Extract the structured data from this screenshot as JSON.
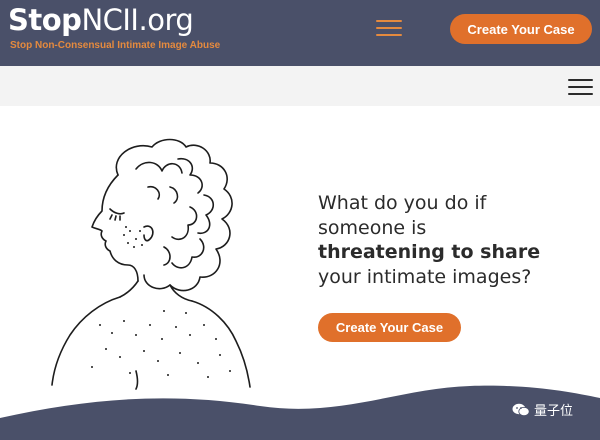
{
  "header": {
    "logo_bold": "Stop",
    "logo_rest": "NCII.org",
    "tagline": "Stop Non-Consensual Intimate Image Abuse",
    "cta_label": "Create Your Case",
    "menu_icon": "hamburger-menu-icon"
  },
  "subbar": {
    "menu_icon": "hamburger-menu-icon"
  },
  "hero": {
    "line_pre": "What do you do if someone is",
    "emphasis": "threatening to share",
    "line_post": " your intimate images?",
    "cta_label": "Create Your Case",
    "illustration": "line-drawing-of-woman"
  },
  "watermark": {
    "text": "量子位",
    "icon": "wechat-icon"
  },
  "colors": {
    "header_bg": "#4a5069",
    "accent": "#e0702b",
    "tagline": "#e58a3e",
    "wave": "#4a5069"
  }
}
